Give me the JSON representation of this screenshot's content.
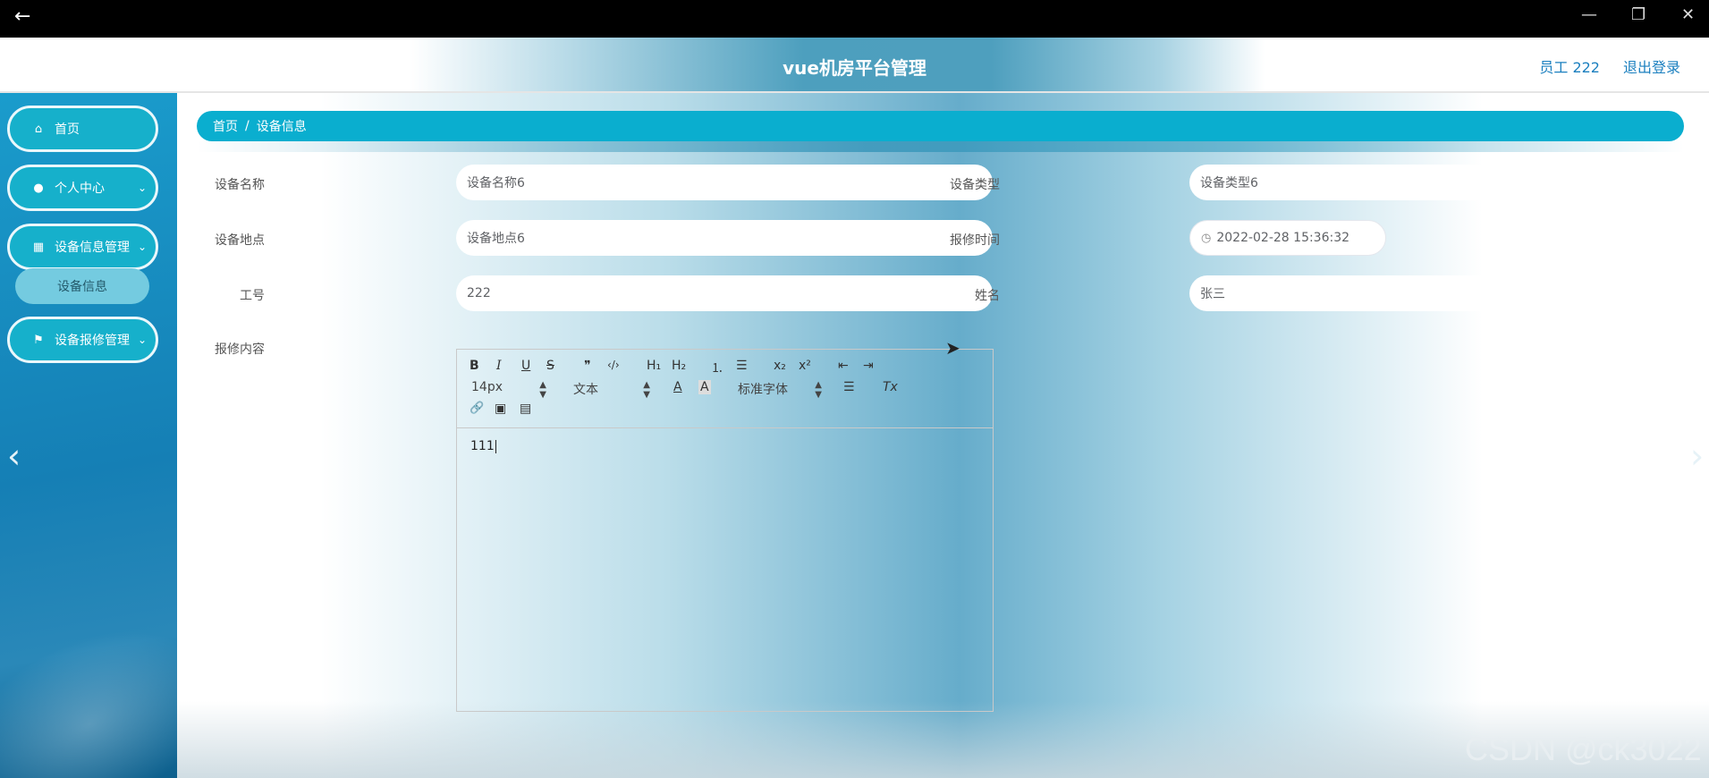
{
  "window": {
    "back_icon": "arrow-left-icon",
    "minimize": "—",
    "restore": "❐",
    "close": "✕"
  },
  "header": {
    "title": "vue机房平台管理",
    "user": "员工 222",
    "logout": "退出登录"
  },
  "sidebar": {
    "items": [
      {
        "label": "首页",
        "icon": "home-icon"
      },
      {
        "label": "个人中心",
        "icon": "user-icon"
      },
      {
        "label": "设备信息管理",
        "icon": "grid-icon"
      },
      {
        "label": "设备报修管理",
        "icon": "flag-icon"
      }
    ],
    "submenu_active": "设备信息"
  },
  "breadcrumb": {
    "home": "首页",
    "separator": "/",
    "current": "设备信息"
  },
  "form": {
    "device_name": {
      "label": "设备名称",
      "value": "设备名称6"
    },
    "device_type": {
      "label": "设备类型",
      "value": "设备类型6"
    },
    "device_location": {
      "label": "设备地点",
      "value": "设备地点6"
    },
    "repair_time": {
      "label": "报修时间",
      "value": "2022-02-28 15:36:32"
    },
    "employee_no": {
      "label": "工号",
      "value": "222"
    },
    "name": {
      "label": "姓名",
      "value": "张三"
    },
    "repair_content": {
      "label": "报修内容",
      "value": "111"
    }
  },
  "editor_toolbar": {
    "font_size": "14px",
    "header_select": "文本",
    "font_family": "标准字体",
    "bold": "B",
    "italic": "I",
    "underline": "U",
    "strike": "S",
    "quote": "❞",
    "code": "‹/›",
    "h1": "H₁",
    "h2": "H₂",
    "ordered_list": "⒈",
    "bullet_list": "☰",
    "subscript": "x₂",
    "superscript": "x²",
    "outdent": "⇤",
    "indent": "⇥",
    "text_color": "A",
    "bg_color": "A",
    "align": "☰",
    "clean": "Tx",
    "link": "🔗",
    "image": "▣",
    "video": "▤"
  },
  "watermark": "CSDN @ck3022",
  "colors": {
    "accent": "#0aaecf",
    "sidebar_bg": "#157fb5",
    "menu_item": "#16b0cb",
    "link": "#1a7fbf"
  }
}
